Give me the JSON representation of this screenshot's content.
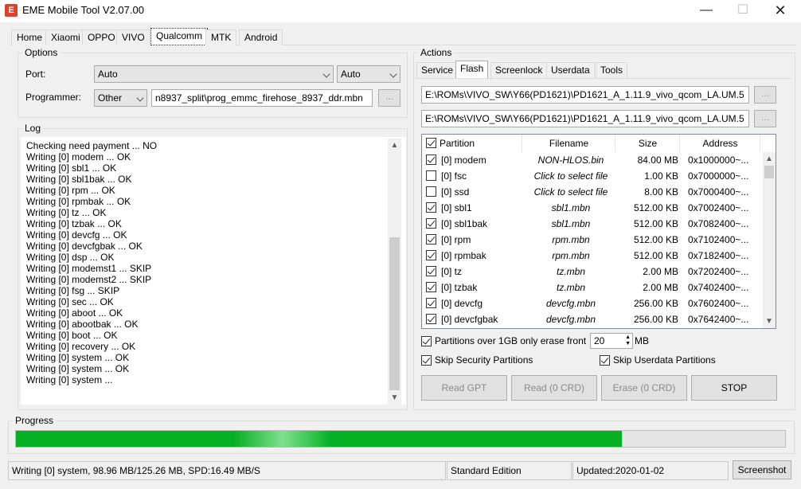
{
  "window": {
    "title": "EME Mobile Tool V2.07.00",
    "icon_letter": "E"
  },
  "main_tabs": [
    {
      "label": "Home"
    },
    {
      "label": "Xiaomi"
    },
    {
      "label": "OPPO"
    },
    {
      "label": "VIVO"
    },
    {
      "label": "Qualcomm"
    },
    {
      "label": "MTK"
    },
    {
      "label": "Android"
    }
  ],
  "options": {
    "title": "Options",
    "port_label": "Port:",
    "port_value": "Auto",
    "port_value2": "Auto",
    "programmer_label": "Programmer:",
    "programmer_type": "Other",
    "programmer_path": "n8937_split\\prog_emmc_firehose_8937_ddr.mbn",
    "browse_label": "..."
  },
  "log": {
    "title": "Log",
    "text": "Checking need payment ... NO\nWriting [0] modem ... OK\nWriting [0] sbl1 ... OK\nWriting [0] sbl1bak ... OK\nWriting [0] rpm ... OK\nWriting [0] rpmbak ... OK\nWriting [0] tz ... OK\nWriting [0] tzbak ... OK\nWriting [0] devcfg ... OK\nWriting [0] devcfgbak ... OK\nWriting [0] dsp ... OK\nWriting [0] modemst1 ... SKIP\nWriting [0] modemst2 ... SKIP\nWriting [0] fsg ... SKIP\nWriting [0] sec ... OK\nWriting [0] aboot ... OK\nWriting [0] abootbak ... OK\nWriting [0] boot ... OK\nWriting [0] recovery ... OK\nWriting [0] system ... OK\nWriting [0] system ... OK\nWriting [0] system ..."
  },
  "actions": {
    "title": "Actions",
    "tabs": [
      {
        "label": "Service"
      },
      {
        "label": "Flash"
      },
      {
        "label": "Screenlock"
      },
      {
        "label": "Userdata"
      },
      {
        "label": "Tools"
      }
    ],
    "path1": "E:\\ROMs\\VIVO_SW\\Y66(PD1621)\\PD1621_A_1.11.9_vivo_qcom_LA.UM.5",
    "path2": "E:\\ROMs\\VIVO_SW\\Y66(PD1621)\\PD1621_A_1.11.9_vivo_qcom_LA.UM.5",
    "browse_label": "...",
    "columns": {
      "partition": "Partition",
      "filename": "Filename",
      "size": "Size",
      "address": "Address"
    },
    "partitions": [
      {
        "checked": true,
        "name": "[0] modem",
        "file": "NON-HLOS.bin",
        "size": "84.00 MB",
        "addr": "0x1000000~..."
      },
      {
        "checked": false,
        "name": "[0] fsc",
        "file": "Click to select file",
        "size": "1.00 KB",
        "addr": "0x7000000~..."
      },
      {
        "checked": false,
        "name": "[0] ssd",
        "file": "Click to select file",
        "size": "8.00 KB",
        "addr": "0x7000400~..."
      },
      {
        "checked": true,
        "name": "[0] sbl1",
        "file": "sbl1.mbn",
        "size": "512.00 KB",
        "addr": "0x7002400~..."
      },
      {
        "checked": true,
        "name": "[0] sbl1bak",
        "file": "sbl1.mbn",
        "size": "512.00 KB",
        "addr": "0x7082400~..."
      },
      {
        "checked": true,
        "name": "[0] rpm",
        "file": "rpm.mbn",
        "size": "512.00 KB",
        "addr": "0x7102400~..."
      },
      {
        "checked": true,
        "name": "[0] rpmbak",
        "file": "rpm.mbn",
        "size": "512.00 KB",
        "addr": "0x7182400~..."
      },
      {
        "checked": true,
        "name": "[0] tz",
        "file": "tz.mbn",
        "size": "2.00 MB",
        "addr": "0x7202400~..."
      },
      {
        "checked": true,
        "name": "[0] tzbak",
        "file": "tz.mbn",
        "size": "2.00 MB",
        "addr": "0x7402400~..."
      },
      {
        "checked": true,
        "name": "[0] devcfg",
        "file": "devcfg.mbn",
        "size": "256.00 KB",
        "addr": "0x7602400~..."
      },
      {
        "checked": true,
        "name": "[0] devcfgbak",
        "file": "devcfg.mbn",
        "size": "256.00 KB",
        "addr": "0x7642400~..."
      }
    ],
    "erase_label": "Partitions over 1GB only erase front",
    "erase_value": "20",
    "erase_unit": "MB",
    "skip_security": "Skip Security Partitions",
    "skip_userdata": "Skip Userdata Partitions",
    "buttons": {
      "read_gpt": "Read GPT",
      "read": "Read (0 CRD)",
      "erase": "Erase (0 CRD)",
      "stop": "STOP"
    }
  },
  "progress": {
    "title": "Progress",
    "fraction": 0.788
  },
  "status": {
    "message": "Writing [0] system, 98.96 MB/125.26 MB, SPD:16.49 MB/S",
    "edition": "Standard Edition",
    "updated": "Updated:2020-01-02",
    "screenshot": "Screenshot"
  }
}
